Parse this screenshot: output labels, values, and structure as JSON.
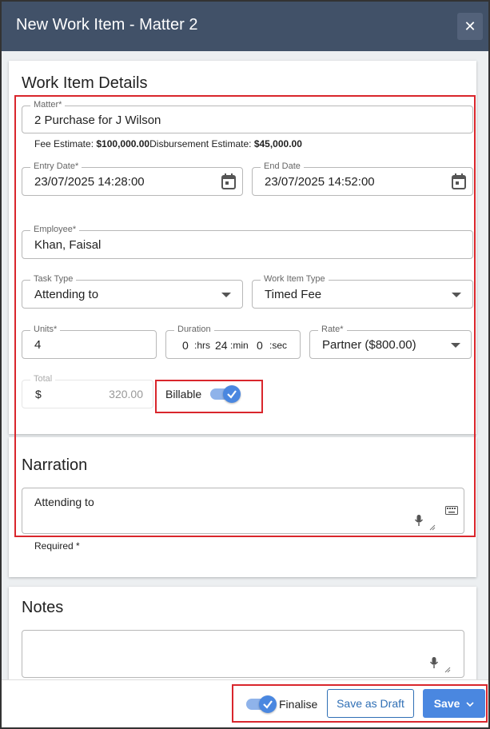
{
  "dialog": {
    "title": "New Work Item - Matter 2",
    "close_glyph": "✕"
  },
  "details": {
    "section_title": "Work Item Details",
    "matter": {
      "label": "Matter*",
      "value": "2 Purchase for J Wilson"
    },
    "fee_estimate_label": "Fee Estimate: ",
    "fee_estimate_value": "$100,000.00",
    "disb_estimate_label": "Disbursement Estimate: ",
    "disb_estimate_value": "$45,000.00",
    "entry_date": {
      "label": "Entry Date*",
      "value": "23/07/2025 14:28:00"
    },
    "end_date": {
      "label": "End Date",
      "value": "23/07/2025 14:52:00"
    },
    "employee": {
      "label": "Employee*",
      "value": "Khan, Faisal"
    },
    "task_type": {
      "label": "Task Type",
      "value": "Attending to"
    },
    "work_item_type": {
      "label": "Work Item Type",
      "value": "Timed Fee"
    },
    "units": {
      "label": "Units*",
      "value": "4"
    },
    "duration": {
      "label": "Duration",
      "hrs": "0",
      "hrs_unit": ":hrs",
      "min": "24",
      "min_unit": ":min",
      "sec": "0",
      "sec_unit": ":sec"
    },
    "rate": {
      "label": "Rate*",
      "value": "Partner ($800.00)"
    },
    "total": {
      "label": "Total",
      "currency": "$",
      "value": "320.00"
    },
    "billable": {
      "label": "Billable",
      "checked": true
    }
  },
  "narration": {
    "section_title": "Narration",
    "value": "Attending to",
    "required_note": "Required *"
  },
  "notes": {
    "section_title": "Notes",
    "value": ""
  },
  "footer": {
    "finalise_label": "Finalise",
    "finalise_checked": true,
    "save_draft_label": "Save as Draft",
    "save_label": "Save"
  },
  "colors": {
    "header": "#415168",
    "accent": "#4a87e0",
    "highlight_border": "#d9262c"
  }
}
